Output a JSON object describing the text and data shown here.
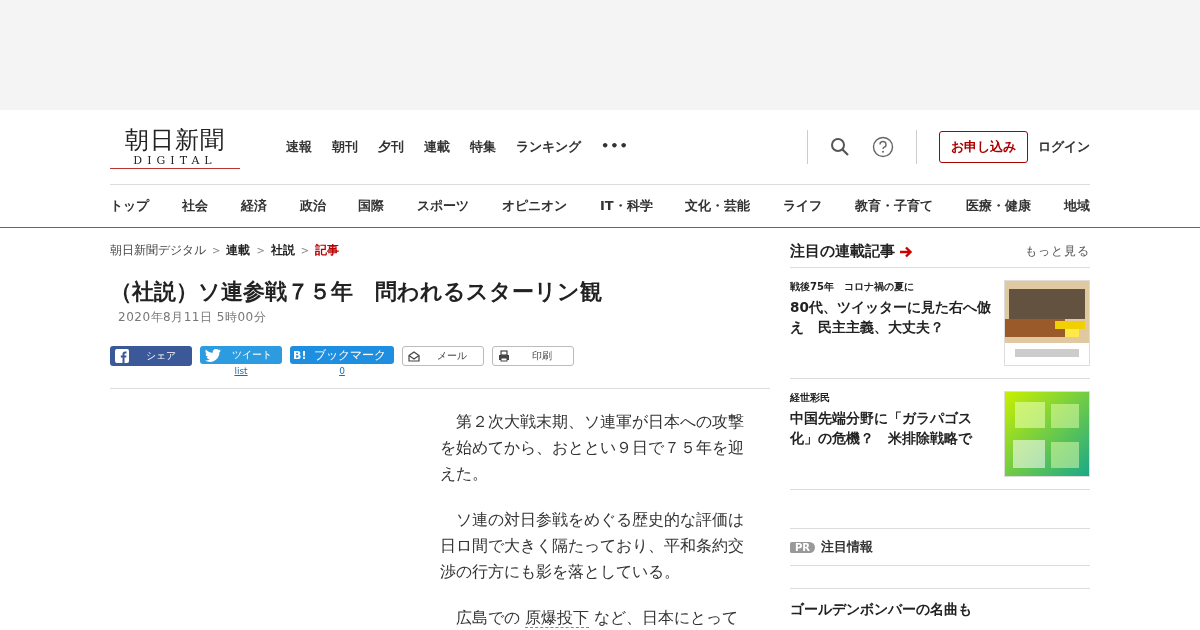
{
  "logo": {
    "title": "朝日新聞",
    "subtitle": "DIGITAL"
  },
  "top_nav": [
    "速報",
    "朝刊",
    "夕刊",
    "連載",
    "特集",
    "ランキング"
  ],
  "more_icon": "•••",
  "header_actions": {
    "subscribe": "お申し込み",
    "login": "ログイン"
  },
  "categories": [
    "トップ",
    "社会",
    "経済",
    "政治",
    "国際",
    "スポーツ",
    "オピニオン",
    "IT・科学",
    "文化・芸能",
    "ライフ",
    "教育・子育て",
    "医療・健康",
    "地域"
  ],
  "breadcrumb_separator": ">",
  "breadcrumb": [
    {
      "label": "朝日新聞デジタル",
      "kind": "plain"
    },
    {
      "label": "連載",
      "kind": "bold"
    },
    {
      "label": "社説",
      "kind": "bold"
    },
    {
      "label": "記事",
      "kind": "current"
    }
  ],
  "article": {
    "title": "（社説）ソ連参戦７５年　問われるスターリン観",
    "date": "2020年8月11日 5時00分",
    "share": [
      {
        "label": "シェア",
        "kind": "facebook"
      },
      {
        "label": "ツイート",
        "kind": "twitter",
        "count": "list"
      },
      {
        "label": "ブックマーク",
        "kind": "hatena",
        "icon": "B!",
        "count": "0"
      },
      {
        "label": "メール",
        "kind": "mail"
      },
      {
        "label": "印刷",
        "kind": "print"
      }
    ],
    "paragraphs": [
      {
        "text": "　第２次大戦末期、ソ連軍が日本への攻撃を始めてから、おととい９日で７５年を迎えた。"
      },
      {
        "text": "　ソ連の対日参戦をめぐる歴史的な評価は日ロ間で大きく隔たっており、平和条約交渉の行方にも影を落としている。"
      },
      {
        "text": "　広島での ",
        "link": "原爆投下",
        "after": " など、日本にとって"
      }
    ]
  },
  "sidebar": {
    "heading": "注目の連載記事",
    "more": "もっと見る",
    "articles": [
      {
        "series": "戦後75年　コロナ禍の夏に",
        "title": "80代、ツイッターに見た右へ倣え　民主主義、大丈夫？"
      },
      {
        "series": "経世彩民",
        "title": "中国先端分野に「ガラパゴス化」の危機？　米排除戦略で"
      }
    ],
    "pr": {
      "badge": "PR",
      "heading": "注目情報"
    },
    "pr_title": "ゴールデンボンバーの名曲も"
  }
}
